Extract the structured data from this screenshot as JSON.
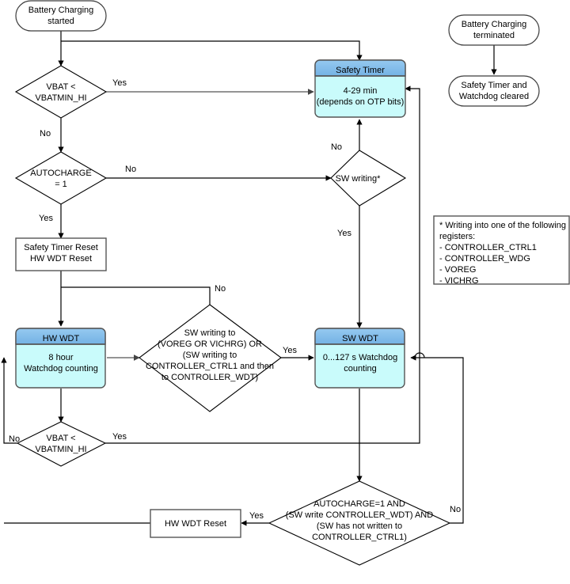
{
  "diagram": {
    "title": "Battery charging watchdog and safety timer flowchart",
    "colors": {
      "state_header_fill": "#7FBCEA",
      "state_body_fill": "#C9FBFB",
      "state_stroke": "#555555",
      "line": "#000000",
      "background": "#FFFFFF"
    }
  },
  "nodes": {
    "start": {
      "type": "terminator",
      "label": "Battery Charging\nstarted",
      "line1": "Battery Charging",
      "line2": "started"
    },
    "terminated": {
      "type": "terminator",
      "line1": "Battery Charging",
      "line2": "terminated"
    },
    "cleared": {
      "type": "terminator",
      "line1": "Safety Timer and",
      "line2": "Watchdog cleared"
    },
    "vbat_top": {
      "type": "decision",
      "line1": "VBAT <",
      "line2": "VBATMIN_HI"
    },
    "autocharge": {
      "type": "decision",
      "line1": "AUTOCHARGE",
      "line2": "= 1"
    },
    "reset_box": {
      "type": "process",
      "line1": "Safety Timer Reset",
      "line2": "HW WDT Reset"
    },
    "safety_timer": {
      "type": "state",
      "header": "Safety Timer",
      "line1": "4-29 min",
      "line2": "(depends on OTP bits)"
    },
    "sw_writing": {
      "type": "decision",
      "line1": "SW writing*"
    },
    "hw_wdt": {
      "type": "state",
      "header": "HW WDT",
      "line1": "8 hour",
      "line2": "Watchdog counting"
    },
    "sw_wdt": {
      "type": "state",
      "header": "SW WDT",
      "line1": "0...127 s Watchdog",
      "line2": "counting"
    },
    "sw_writing_to": {
      "type": "decision",
      "line1": "SW writing to",
      "line2": "(VOREG OR VICHRG) OR",
      "line3": "(SW writing to",
      "line4": "CONTROLLER_CTRL1 and then",
      "line5": "to CONTROLLER_WDT)"
    },
    "vbat_bottom": {
      "type": "decision",
      "line1": "VBAT <",
      "line2": "VBATMIN_HI"
    },
    "autocharge_and": {
      "type": "decision",
      "line1": "AUTOCHARGE=1 AND",
      "line2": "(SW write CONTROLLER_WDT) AND",
      "line3": "(SW has not written to",
      "line4": "CONTROLLER_CTRL1)"
    },
    "hw_wdt_reset": {
      "type": "process",
      "line1": "HW WDT Reset"
    }
  },
  "note": {
    "line1": "* Writing into one of the following",
    "line2": "registers:",
    "line3": "- CONTROLLER_CTRL1",
    "line4": "- CONTROLLER_WDG",
    "line5": "- VOREG",
    "line6": "- VICHRG"
  },
  "edge_labels": {
    "vbat_top_yes": "Yes",
    "vbat_top_no": "No",
    "autocharge_no": "No",
    "autocharge_yes": "Yes",
    "sw_writing_no": "No",
    "sw_writing_yes": "Yes",
    "sw_writing_to_no": "No",
    "sw_writing_to_yes": "Yes",
    "vbat_bottom_no": "No",
    "vbat_bottom_yes": "Yes",
    "autocharge_and_yes": "Yes",
    "autocharge_and_no": "No"
  }
}
